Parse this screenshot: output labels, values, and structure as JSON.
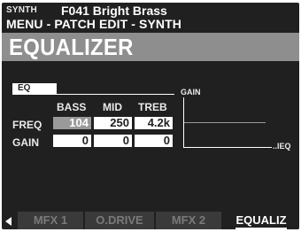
{
  "header": {
    "section": "SYNTH",
    "patch": "F041 Bright Brass",
    "breadcrumb": "MENU - PATCH EDIT - SYNTH"
  },
  "page": {
    "title": "EQUALIZER"
  },
  "eq": {
    "tab_label": "EQ",
    "columns": [
      "BASS",
      "MID",
      "TREB"
    ],
    "rows": {
      "freq": {
        "label": "FREQ",
        "values": [
          "104",
          "250",
          "4.2k"
        ]
      },
      "gain": {
        "label": "GAIN",
        "values": [
          "0",
          "0",
          "0"
        ]
      }
    }
  },
  "graph": {
    "y_label": "GAIN",
    "x_label": "..IEQ"
  },
  "tabs": [
    {
      "label": "MFX 1",
      "active": false
    },
    {
      "label": "O.DRIVE",
      "active": false
    },
    {
      "label": "MFX 2",
      "active": false
    },
    {
      "label": "EQUALIZ",
      "active": true
    }
  ],
  "colors": {
    "screen_bg": "#202020",
    "title_bar": "#8e8e8e",
    "selected_cell": "#9a9a9a",
    "foreground": "#ffffff"
  }
}
